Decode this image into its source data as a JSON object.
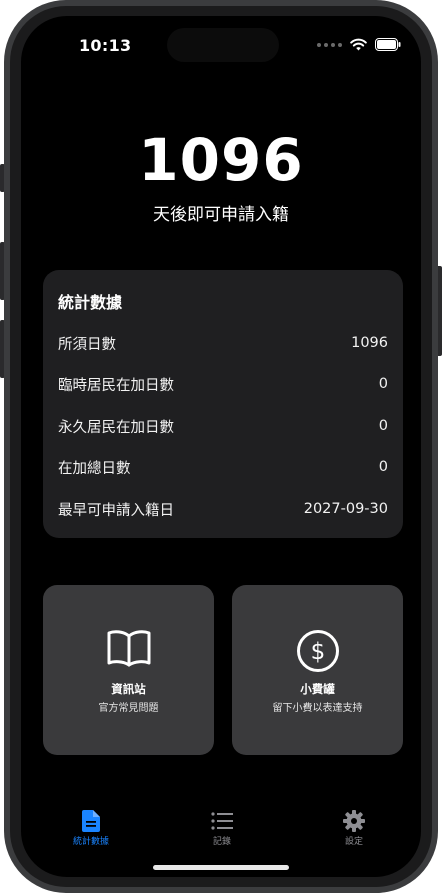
{
  "status_bar": {
    "time": "10:13"
  },
  "headline": {
    "days": "1096",
    "subtitle": "天後即可申請入籍"
  },
  "stats_card": {
    "title": "統計數據",
    "rows": [
      {
        "label": "所須日數",
        "value": "1096"
      },
      {
        "label": "臨時居民在加日數",
        "value": "0"
      },
      {
        "label": "永久居民在加日數",
        "value": "0"
      },
      {
        "label": "在加總日數",
        "value": "0"
      },
      {
        "label": "最早可申請入籍日",
        "value": "2027-09-30"
      }
    ]
  },
  "tiles": [
    {
      "icon": "book-icon",
      "title": "資訊站",
      "subtitle": "官方常見問題"
    },
    {
      "icon": "dollar-circle-icon",
      "title": "小費罐",
      "subtitle": "留下小費以表達支持"
    }
  ],
  "tab_bar": {
    "active_color": "#1a84ff",
    "inactive_color": "#8e8e93",
    "tabs": [
      {
        "icon": "document-icon",
        "label": "統計數據",
        "active": true
      },
      {
        "icon": "list-icon",
        "label": "記錄",
        "active": false
      },
      {
        "icon": "gear-icon",
        "label": "設定",
        "active": false
      }
    ]
  }
}
